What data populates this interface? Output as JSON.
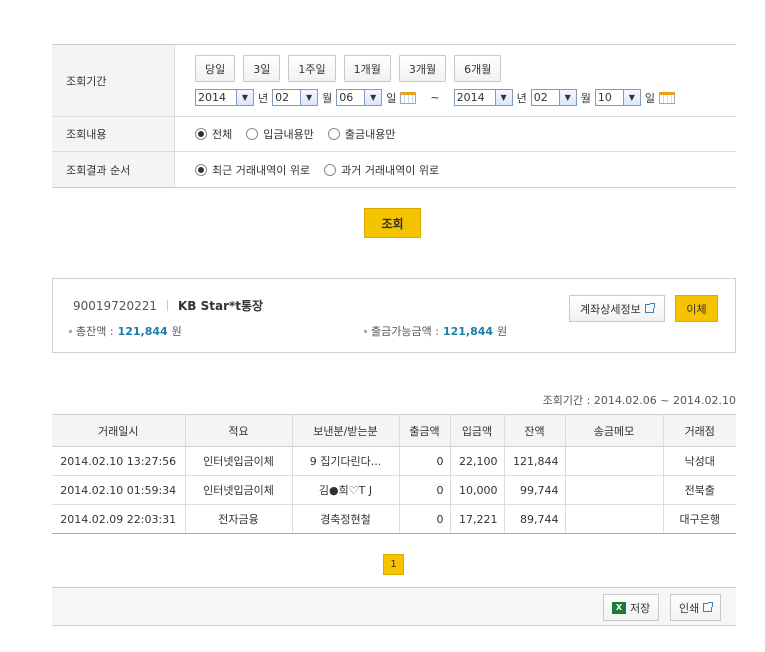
{
  "filter": {
    "period_label": "조회기간",
    "period_buttons": [
      "당일",
      "3일",
      "1주일",
      "1개월",
      "3개월",
      "6개월"
    ],
    "from": {
      "year": "2014",
      "month": "02",
      "day": "06"
    },
    "to": {
      "year": "2014",
      "month": "02",
      "day": "10"
    },
    "unit_year": "년",
    "unit_month": "월",
    "unit_day": "일",
    "tilde": "~",
    "content_label": "조회내용",
    "content_options": [
      "전체",
      "입금내용만",
      "출금내용만"
    ],
    "content_selected": 0,
    "order_label": "조회결과 순서",
    "order_options": [
      "최근 거래내역이 위로",
      "과거 거래내역이 위로"
    ],
    "order_selected": 0
  },
  "search_button": "조회",
  "account": {
    "number": "90019720221",
    "name": "KB Star*t통장",
    "total_label": "총잔액 :",
    "total_value": "121,844",
    "available_label": "출금가능금액 :",
    "available_value": "121,844",
    "currency": "원",
    "detail_button": "계좌상세정보",
    "transfer_button": "이체"
  },
  "results": {
    "period_text": "조회기간 : 2014.02.06 ~ 2014.02.10",
    "columns": [
      "거래일시",
      "적요",
      "보낸분/받는분",
      "출금액",
      "입금액",
      "잔액",
      "송금메모",
      "거래점"
    ],
    "rows": [
      [
        "2014.02.10 13:27:56",
        "인터넷입금이체",
        "9 집기다린다...",
        "0",
        "22,100",
        "121,844",
        "",
        "낙성대"
      ],
      [
        "2014.02.10 01:59:34",
        "인터넷입금이체",
        "김●희♡T J",
        "0",
        "10,000",
        "99,744",
        "",
        "전북출"
      ],
      [
        "2014.02.09 22:03:31",
        "전자금융",
        "경축정현철",
        "0",
        "17,221",
        "89,744",
        "",
        "대구은행"
      ]
    ]
  },
  "pagination": {
    "current": "1"
  },
  "footer": {
    "save_button": "저장",
    "print_button": "인쇄"
  }
}
